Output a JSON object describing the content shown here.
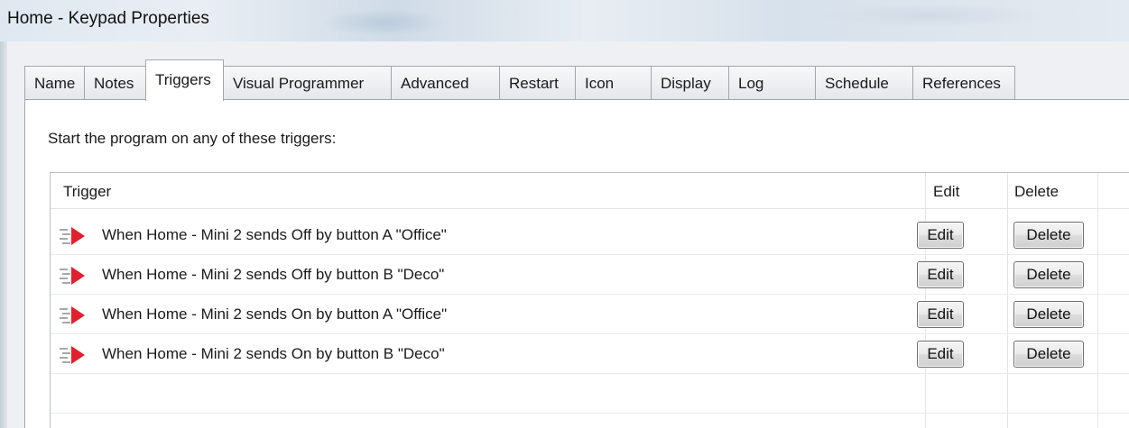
{
  "window": {
    "title": "Home - Keypad Properties"
  },
  "tabs": [
    {
      "label": "Name",
      "active": false
    },
    {
      "label": "Notes",
      "active": false
    },
    {
      "label": "Triggers",
      "active": true
    },
    {
      "label": "Visual Programmer",
      "active": false
    },
    {
      "label": "Advanced",
      "active": false
    },
    {
      "label": "Restart",
      "active": false
    },
    {
      "label": "Icon",
      "active": false
    },
    {
      "label": "Display",
      "active": false
    },
    {
      "label": "Log",
      "active": false
    },
    {
      "label": "Schedule",
      "active": false
    },
    {
      "label": "References",
      "active": false
    }
  ],
  "triggers_panel": {
    "instruction": "Start the program on any of these triggers:",
    "columns": {
      "trigger": "Trigger",
      "edit": "Edit",
      "delete": "Delete"
    },
    "rows": [
      {
        "text": "When Home - Mini 2 sends Off by button A \"Office\"",
        "edit_label": "Edit",
        "delete_label": "Delete"
      },
      {
        "text": "When Home - Mini 2 sends Off by button B \"Deco\"",
        "edit_label": "Edit",
        "delete_label": "Delete"
      },
      {
        "text": "When Home - Mini 2 sends On by button A \"Office\"",
        "edit_label": "Edit",
        "delete_label": "Delete"
      },
      {
        "text": "When Home - Mini 2 sends On by button B \"Deco\"",
        "edit_label": "Edit",
        "delete_label": "Delete"
      }
    ]
  },
  "colors": {
    "trigger_icon": "#e0202c"
  },
  "icons": {
    "row_icon": "trigger-arrow-icon"
  }
}
